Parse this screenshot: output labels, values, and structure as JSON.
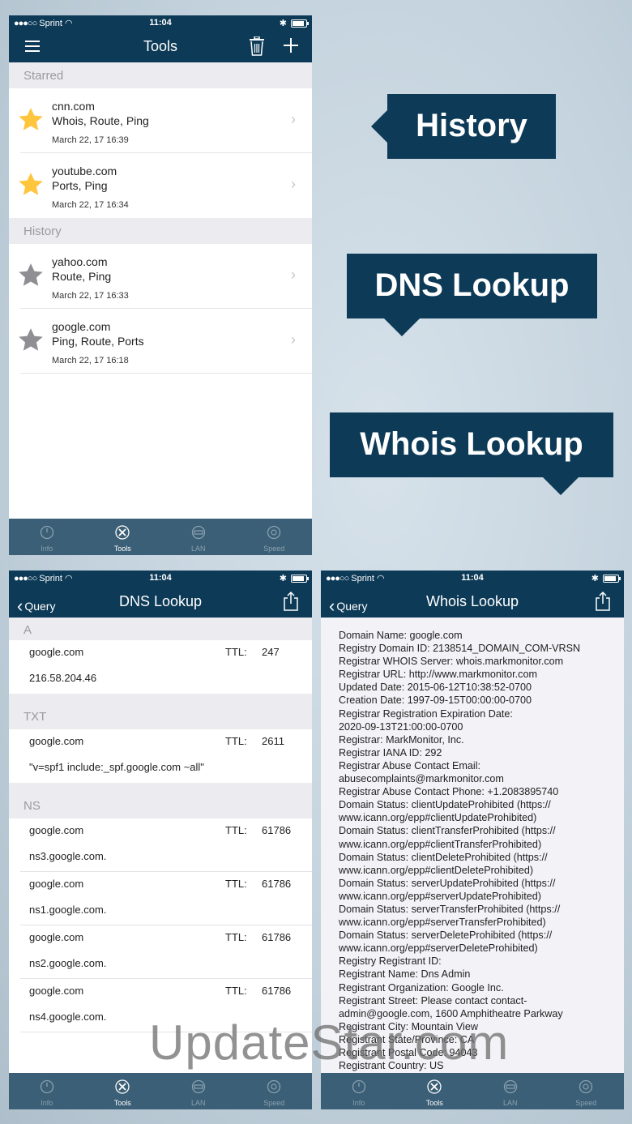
{
  "colors": {
    "nav": "#0d3a57",
    "tabbar": "#3b5f76",
    "star_gold": "#ffc53d",
    "star_gray": "#8e8e93",
    "callout": "#0d3a57"
  },
  "status": {
    "carrier": "Sprint",
    "time": "11:04"
  },
  "callouts": {
    "history": "History",
    "dns": "DNS Lookup",
    "whois": "Whois Lookup"
  },
  "tabs": [
    {
      "label": "Info",
      "icon": "gauge-icon"
    },
    {
      "label": "Tools",
      "icon": "tools-icon"
    },
    {
      "label": "LAN",
      "icon": "router-icon"
    },
    {
      "label": "Speed",
      "icon": "speedometer-icon"
    }
  ],
  "tools": {
    "title": "Tools",
    "starred_header": "Starred",
    "history_header": "History",
    "starred": [
      {
        "host": "cnn.com",
        "tools": "Whois, Route, Ping",
        "date": "March 22, 17 16:39"
      },
      {
        "host": "youtube.com",
        "tools": "Ports, Ping",
        "date": "March 22, 17 16:34"
      }
    ],
    "history": [
      {
        "host": "yahoo.com",
        "tools": "Route, Ping",
        "date": "March 22, 17 16:33"
      },
      {
        "host": "google.com",
        "tools": "Ping, Route, Ports",
        "date": "March 22, 17 16:18"
      }
    ]
  },
  "dns": {
    "title": "DNS Lookup",
    "back": "Query",
    "ttl_label": "TTL:",
    "sections": [
      {
        "type": "A",
        "records": [
          {
            "host": "google.com",
            "ttl": "247",
            "value": "216.58.204.46"
          }
        ]
      },
      {
        "type": "TXT",
        "records": [
          {
            "host": "google.com",
            "ttl": "2611",
            "value": "\"v=spf1 include:_spf.google.com ~all\""
          }
        ]
      },
      {
        "type": "NS",
        "records": [
          {
            "host": "google.com",
            "ttl": "61786",
            "value": "ns3.google.com."
          },
          {
            "host": "google.com",
            "ttl": "61786",
            "value": "ns1.google.com."
          },
          {
            "host": "google.com",
            "ttl": "61786",
            "value": "ns2.google.com."
          },
          {
            "host": "google.com",
            "ttl": "61786",
            "value": "ns4.google.com."
          }
        ]
      }
    ]
  },
  "whois": {
    "title": "Whois Lookup",
    "back": "Query",
    "lines": [
      "Domain Name: google.com",
      "Registry Domain ID: 2138514_DOMAIN_COM-VRSN",
      "Registrar WHOIS Server: whois.markmonitor.com",
      "Registrar URL: http://www.markmonitor.com",
      "Updated Date: 2015-06-12T10:38:52-0700",
      "Creation Date: 1997-09-15T00:00:00-0700",
      "Registrar Registration Expiration Date:",
      "2020-09-13T21:00:00-0700",
      "Registrar: MarkMonitor, Inc.",
      "Registrar IANA ID: 292",
      "Registrar Abuse Contact Email:",
      "abusecomplaints@markmonitor.com",
      "Registrar Abuse Contact Phone: +1.2083895740",
      "Domain Status: clientUpdateProhibited (https://",
      "www.icann.org/epp#clientUpdateProhibited)",
      "Domain Status: clientTransferProhibited (https://",
      "www.icann.org/epp#clientTransferProhibited)",
      "Domain Status: clientDeleteProhibited (https://",
      "www.icann.org/epp#clientDeleteProhibited)",
      "Domain Status: serverUpdateProhibited (https://",
      "www.icann.org/epp#serverUpdateProhibited)",
      "Domain Status: serverTransferProhibited (https://",
      "www.icann.org/epp#serverTransferProhibited)",
      "Domain Status: serverDeleteProhibited (https://",
      "www.icann.org/epp#serverDeleteProhibited)",
      "Registry Registrant ID:",
      "Registrant Name: Dns Admin",
      "Registrant Organization: Google Inc.",
      "Registrant Street: Please contact contact-",
      "admin@google.com, 1600 Amphitheatre Parkway",
      "Registrant City: Mountain View",
      "Registrant State/Province: CA",
      "Registrant Postal Code: 94043",
      "Registrant Country: US"
    ]
  },
  "watermark": "UpdateStar.com"
}
